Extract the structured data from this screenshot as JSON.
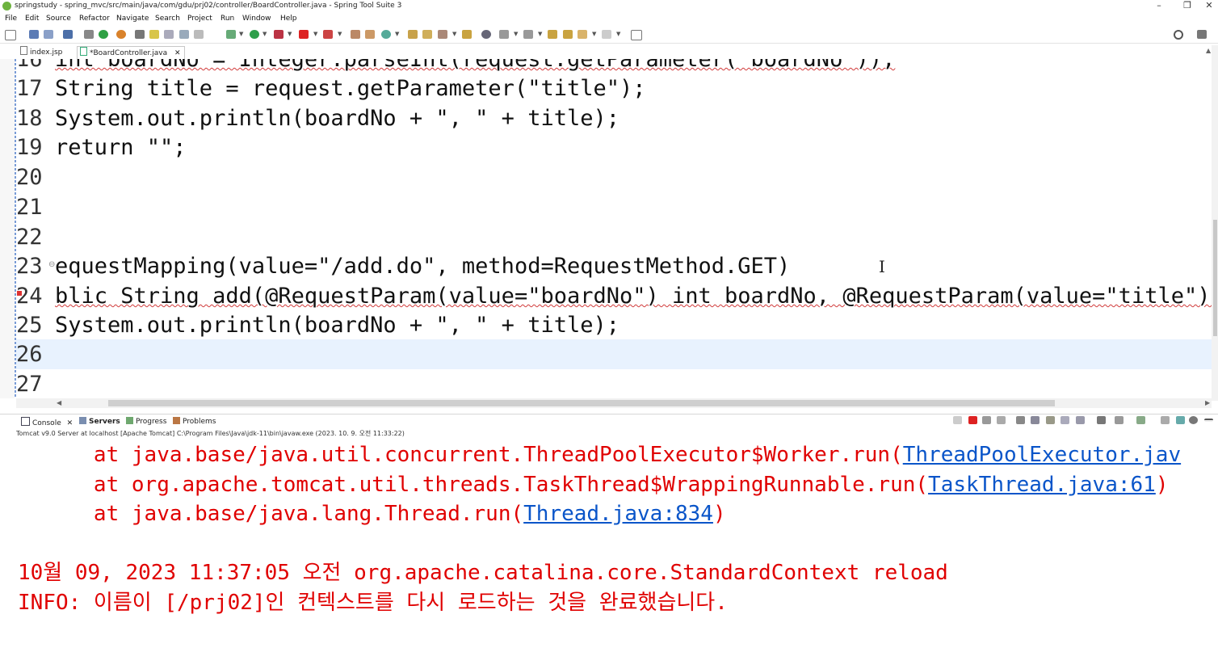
{
  "window": {
    "title": "springstudy - spring_mvc/src/main/java/com/gdu/prj02/controller/BoardController.java - Spring Tool Suite 3",
    "minimize": "–",
    "restore": "❐",
    "close": "✕"
  },
  "menu": [
    "File",
    "Edit",
    "Source",
    "Refactor",
    "Navigate",
    "Search",
    "Project",
    "Run",
    "Window",
    "Help"
  ],
  "editor_tabs": [
    {
      "label": "index.jsp",
      "active": false
    },
    {
      "label": "*BoardController.java",
      "active": true,
      "close": "✕"
    }
  ],
  "editor": {
    "lines": [
      {
        "num": "16",
        "text": "int boardNo = Integer.parseInt(request.getParameter(\"boardNo\"));"
      },
      {
        "num": "17",
        "text": "String title = request.getParameter(\"title\");"
      },
      {
        "num": "18",
        "text": "System.out.println(boardNo + \", \" + title);"
      },
      {
        "num": "19",
        "text": "return \"\";"
      },
      {
        "num": "20",
        "text": ""
      },
      {
        "num": "21",
        "text": ""
      },
      {
        "num": "22",
        "text": ""
      },
      {
        "num": "23",
        "text": "equestMapping(value=\"/add.do\", method=RequestMethod.GET)"
      },
      {
        "num": "24",
        "text": "blic String add(@RequestParam(value=\"boardNo\") int boardNo, @RequestParam(value=\"title\") S"
      },
      {
        "num": "25",
        "text": "System.out.println(boardNo + \", \" + title);"
      },
      {
        "num": "26",
        "text": ""
      },
      {
        "num": "27",
        "text": ""
      }
    ]
  },
  "console_tabs": [
    {
      "label": "Console",
      "close": "✕"
    },
    {
      "label": "Servers"
    },
    {
      "label": "Progress"
    },
    {
      "label": "Problems"
    }
  ],
  "console": {
    "status": "Tomcat v9.0 Server at localhost [Apache Tomcat] C:\\Program Files\\Java\\jdk-11\\bin\\javaw.exe  (2023. 10. 9. 오전 11:33:22)",
    "lines": [
      {
        "prefix": "\tat java.base/java.util.concurrent.ThreadPoolExecutor$Worker.run(",
        "link": "ThreadPoolExecutor.jav",
        "suffix": ""
      },
      {
        "prefix": "\tat org.apache.tomcat.util.threads.TaskThread$WrappingRunnable.run(",
        "link": "TaskThread.java:61",
        "suffix": ")"
      },
      {
        "prefix": "\tat java.base/java.lang.Thread.run(",
        "link": "Thread.java:834",
        "suffix": ")"
      },
      {
        "prefix": "",
        "link": "",
        "suffix": ""
      },
      {
        "prefix": "10월 09, 2023 11:37:05 오전 org.apache.catalina.core.StandardContext reload",
        "link": "",
        "suffix": ""
      },
      {
        "prefix": "INFO: 이름이 [/prj02]인 컨텍스트를 다시 로드하는 것을 완료했습니다.",
        "link": "",
        "suffix": ""
      }
    ]
  },
  "colors": {
    "error_text": "#e00000",
    "link": "#0a55c9",
    "current_line": "#e8f2fe",
    "string": "#2a00ff",
    "keyword": "#7f0055"
  }
}
